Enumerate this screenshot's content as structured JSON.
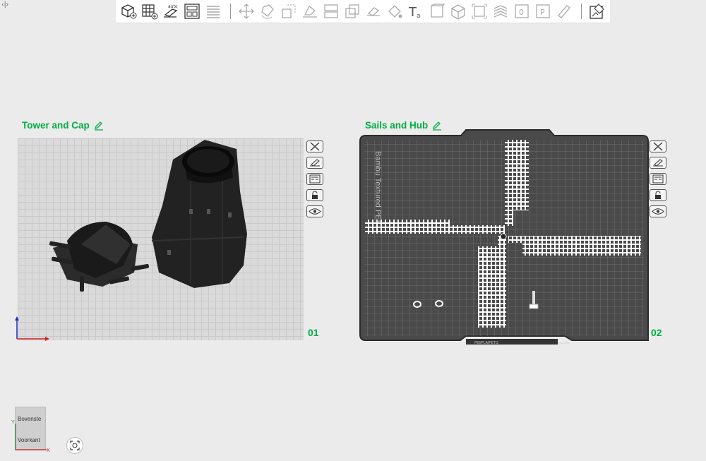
{
  "corner_mark": "‹|›",
  "toolbar": {
    "icons": [
      "add-cube-icon",
      "add-plate-icon",
      "auto-orient-icon",
      "arrange-icon",
      "layers-icon",
      "move-icon",
      "rotate-icon",
      "scale-icon",
      "lay-on-face-icon",
      "split-icon",
      "cut-icon",
      "boolean-icon",
      "paint-icon",
      "text-icon",
      "emboss-icon",
      "measure-icon",
      "assembly-icon",
      "support-paint-icon",
      "seam-icon",
      "fuzzy-skin-icon",
      "brim-ears-icon",
      "plate-settings-icon"
    ]
  },
  "plates": [
    {
      "title": "Tower and Cap",
      "number": "01"
    },
    {
      "title": "Sails and Hub",
      "number": "02"
    }
  ],
  "plate2": {
    "bed_text": "Bambu Textured PEI",
    "footer_text": "PEI/PLA/PETG",
    "footer_small": "Low temp"
  },
  "view_cube": {
    "top": "Bovenste",
    "front": "Voorkant",
    "axis_x": "X",
    "axis_y": "Y"
  },
  "colors": {
    "accent": "#00ae42",
    "bed_dark": "#4a4a4a",
    "bed_light": "#dadada"
  }
}
